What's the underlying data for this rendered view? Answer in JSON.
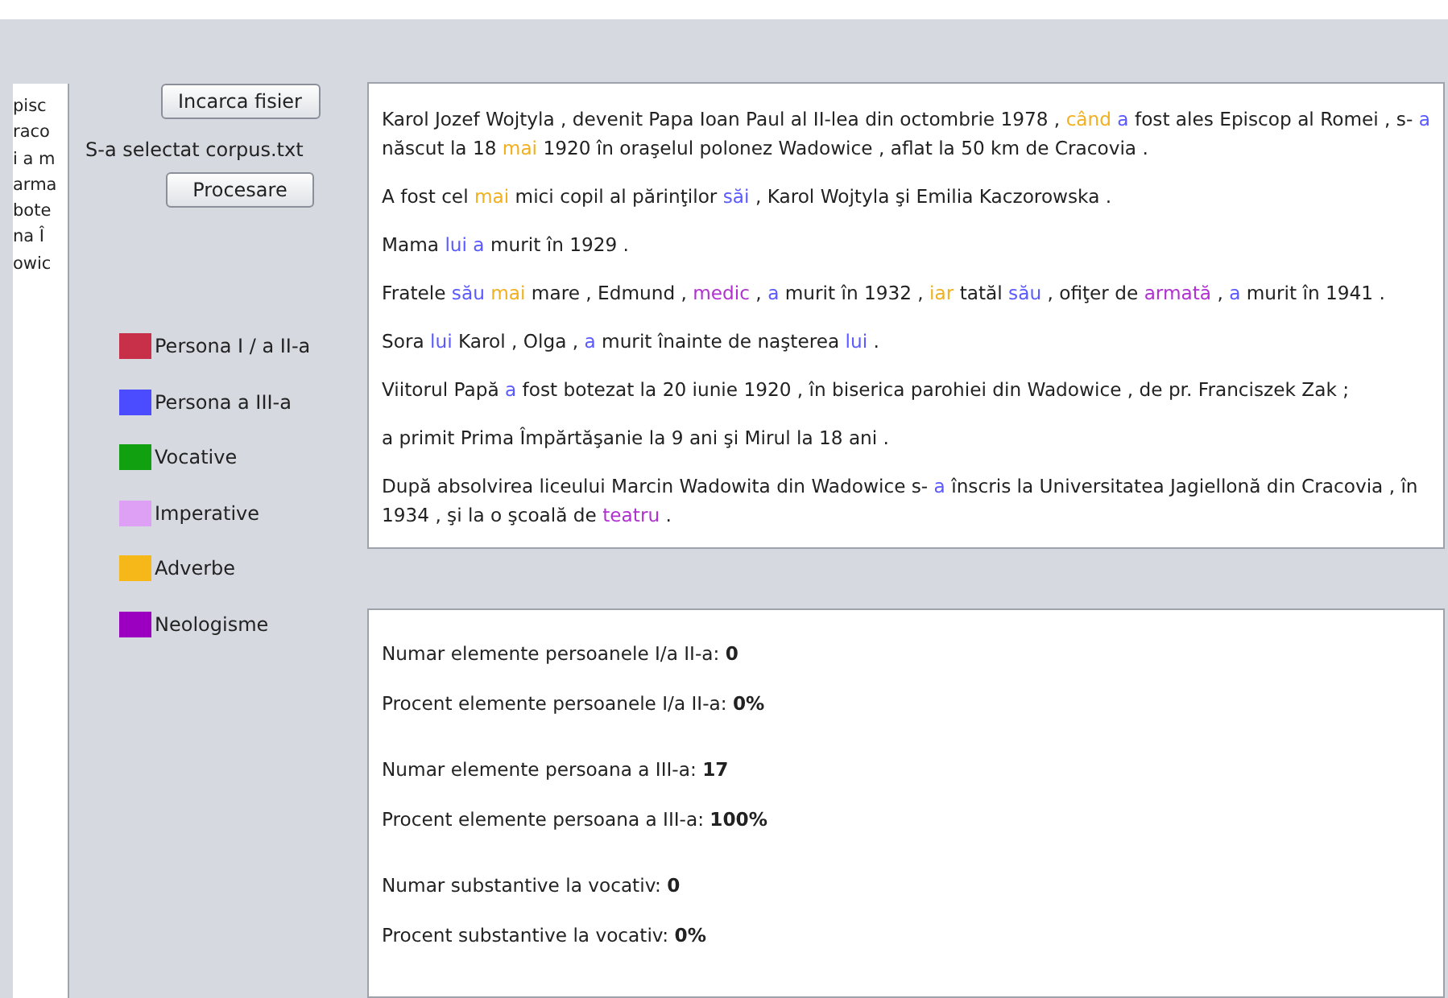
{
  "left_panel_lines": [
    "pisc",
    "raco",
    "i a m",
    "arma",
    "bote",
    "na Î",
    "owic"
  ],
  "load_button": "Incarca fisier",
  "selected_file": "S-a selectat corpus.txt",
  "process_button": "Procesare",
  "legend": [
    {
      "label": "Persona I / a II-a",
      "color": "#c8304a"
    },
    {
      "label": "Persona a III-a",
      "color": "#4b4bff"
    },
    {
      "label": "Vocative",
      "color": "#10a010"
    },
    {
      "label": "Imperative",
      "color": "#dda0f5"
    },
    {
      "label": "Adverbe",
      "color": "#f5b818"
    },
    {
      "label": "Neologisme",
      "color": "#9b00c0"
    }
  ],
  "paragraphs": [
    [
      {
        "text": "Karol Jozef Wojtyla , devenit Papa Ioan Paul al II-lea din octombrie 1978 , "
      },
      {
        "text": "când",
        "color": "#f0b020"
      },
      {
        "text": " a",
        "color": "#5a5aff"
      },
      {
        "text": " fost ales Episcop al Romei , s- "
      },
      {
        "text": "a",
        "color": "#5a5aff"
      },
      {
        "text": " născut la 18 "
      },
      {
        "text": "mai",
        "color": "#f0b020"
      },
      {
        "text": " 1920 în oraşelul polonez Wadowice , aflat la 50 km de Cracovia ."
      }
    ],
    [
      {
        "text": "A fost cel "
      },
      {
        "text": "mai",
        "color": "#f0b020"
      },
      {
        "text": " mici copil al părinţilor "
      },
      {
        "text": "săi",
        "color": "#5a5aff"
      },
      {
        "text": " , Karol Wojtyla şi Emilia Kaczorowska ."
      }
    ],
    [
      {
        "text": "Mama "
      },
      {
        "text": "lui",
        "color": "#5a5aff"
      },
      {
        "text": " a",
        "color": "#5a5aff"
      },
      {
        "text": " murit în 1929 ."
      }
    ],
    [
      {
        "text": "Fratele "
      },
      {
        "text": "său",
        "color": "#5a5aff"
      },
      {
        "text": " mai",
        "color": "#f0b020"
      },
      {
        "text": " mare , Edmund , "
      },
      {
        "text": "medic",
        "color": "#b030d0"
      },
      {
        "text": " , "
      },
      {
        "text": "a",
        "color": "#5a5aff"
      },
      {
        "text": " murit în 1932 , "
      },
      {
        "text": "iar",
        "color": "#f0b020"
      },
      {
        "text": " tatăl "
      },
      {
        "text": "său",
        "color": "#5a5aff"
      },
      {
        "text": " , ofiţer de "
      },
      {
        "text": "armată",
        "color": "#b030d0"
      },
      {
        "text": " , "
      },
      {
        "text": "a",
        "color": "#5a5aff"
      },
      {
        "text": " murit în 1941 ."
      }
    ],
    [
      {
        "text": "Sora "
      },
      {
        "text": "lui",
        "color": "#5a5aff"
      },
      {
        "text": " Karol , Olga , "
      },
      {
        "text": "a",
        "color": "#5a5aff"
      },
      {
        "text": " murit înainte de naşterea "
      },
      {
        "text": "lui",
        "color": "#5a5aff"
      },
      {
        "text": " ."
      }
    ],
    [
      {
        "text": "Viitorul Papă "
      },
      {
        "text": "a",
        "color": "#5a5aff"
      },
      {
        "text": " fost botezat la 20 iunie 1920 , în biserica parohiei din Wadowice , de pr. Franciszek Zak ;"
      }
    ],
    [
      {
        "text": "a primit Prima Împărtăşanie la 9 ani şi Mirul la 18 ani ."
      }
    ],
    [
      {
        "text": "După absolvirea liceului Marcin Wadowita din Wadowice s- "
      },
      {
        "text": "a",
        "color": "#5a5aff"
      },
      {
        "text": " înscris la Universitatea Jagiellonă din Cracovia , în 1934 , şi la o şcoală de "
      },
      {
        "text": "teatru",
        "color": "#b030d0"
      },
      {
        "text": " ."
      }
    ]
  ],
  "stats": [
    [
      "Numar elemente persoanele I/a II-a: **0**",
      "Procent elemente persoanele I/a II-a: **0%**"
    ],
    [
      "Numar elemente persoana a III-a: **17**",
      "Procent elemente persoana a III-a: **100%**"
    ],
    [
      "Numar substantive la vocativ: **0**",
      "Procent substantive la vocativ: **0%**"
    ]
  ]
}
